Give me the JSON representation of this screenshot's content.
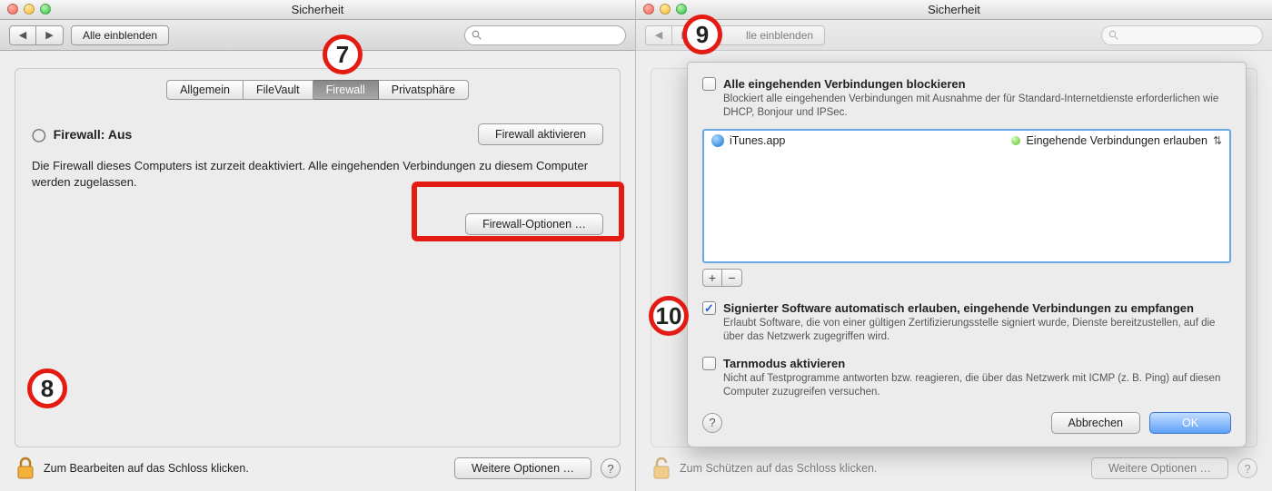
{
  "left": {
    "window_title": "Sicherheit",
    "toolbar": {
      "show_all": "Alle einblenden"
    },
    "tabs": [
      "Allgemein",
      "FileVault",
      "Firewall",
      "Privatsphäre"
    ],
    "active_tab_index": 2,
    "status_label": "Firewall: Aus",
    "description": "Die Firewall dieses Computers ist zurzeit deaktiviert. Alle eingehenden Verbindungen zu diesem Computer werden zugelassen.",
    "activate_button": "Firewall aktivieren",
    "options_button": "Firewall-Optionen …",
    "footer": {
      "lock_label": "Zum Bearbeiten auf das Schloss klicken.",
      "more_options": "Weitere Optionen …"
    }
  },
  "right": {
    "window_title": "Sicherheit",
    "toolbar": {
      "show_all": "lle einblenden"
    },
    "footer": {
      "lock_label": "Zum Schützen auf das Schloss klicken.",
      "more_options": "Weitere Optionen …"
    },
    "dialog": {
      "block_all": {
        "checked": false,
        "title": "Alle eingehenden Verbindungen blockieren",
        "sub": "Blockiert alle eingehenden Verbindungen mit Ausnahme der für Standard-Internetdienste erforderlichen wie DHCP, Bonjour und IPSec."
      },
      "apps": [
        {
          "name": "iTunes.app",
          "status": "Eingehende Verbindungen erlauben"
        }
      ],
      "signed": {
        "checked": true,
        "title": "Signierter Software automatisch erlauben, eingehende Verbindungen zu empfangen",
        "sub": "Erlaubt Software, die von einer gültigen Zertifizierungsstelle signiert wurde, Dienste bereitzustellen, auf die über das Netzwerk zugegriffen wird."
      },
      "stealth": {
        "checked": false,
        "title": "Tarnmodus aktivieren",
        "sub": "Nicht auf Testprogramme antworten bzw. reagieren, die über das Netzwerk mit ICMP (z. B. Ping) auf diesen Computer zuzugreifen versuchen."
      },
      "cancel": "Abbrechen",
      "ok": "OK"
    }
  },
  "badges": {
    "n7": "7",
    "n8": "8",
    "n9": "9",
    "n10": "10"
  }
}
